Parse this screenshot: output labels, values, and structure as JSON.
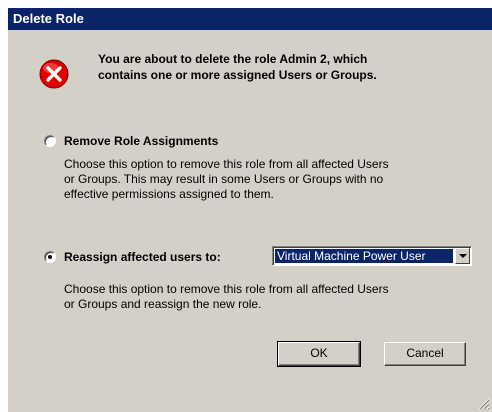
{
  "window": {
    "title": "Delete Role"
  },
  "message": {
    "icon": "error-icon",
    "line1": "You are about to delete the role Admin 2, which",
    "line2": "contains one or more assigned Users or Groups."
  },
  "options": {
    "remove": {
      "label": "Remove Role Assignments",
      "selected": false,
      "description": [
        "Choose this option to remove this role from all affected Users",
        "or Groups.  This may result in some Users or Groups with no",
        "effective permissions assigned to them."
      ]
    },
    "reassign": {
      "label": "Reassign affected users to:",
      "selected": true,
      "role_select_value": "Virtual Machine Power User",
      "description": [
        "Choose this option to remove this role from all affected Users",
        "or Groups and reassign the new role."
      ]
    }
  },
  "buttons": {
    "ok": "OK",
    "cancel": "Cancel"
  },
  "colors": {
    "titlebar": "#0a246a",
    "dialog_bg": "#d4d0c8",
    "error_red": "#e00000"
  }
}
